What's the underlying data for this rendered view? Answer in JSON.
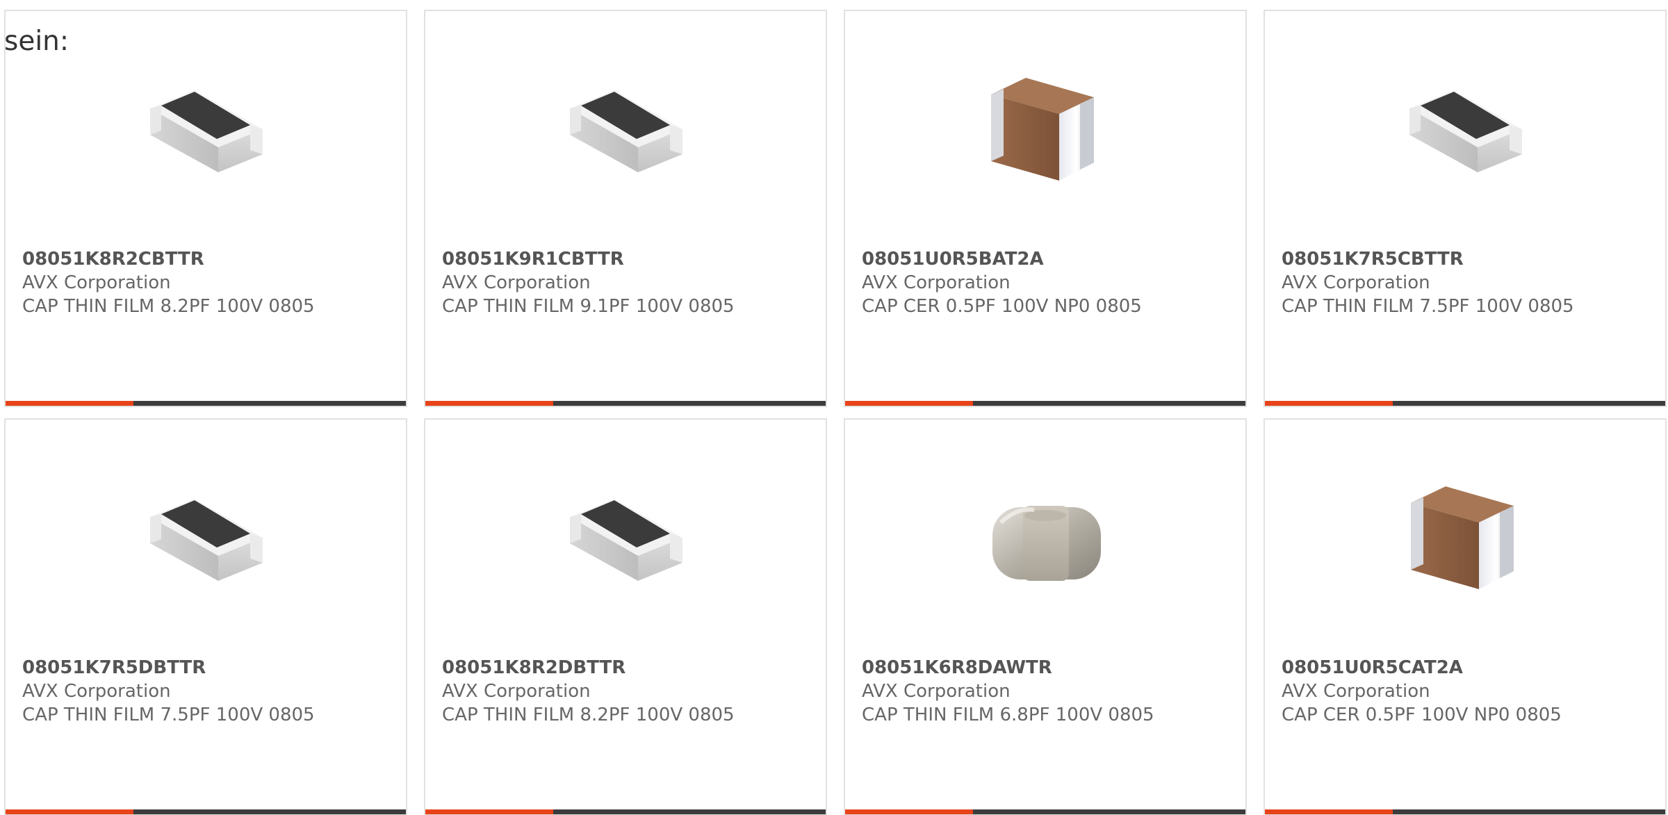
{
  "lead_text": "sein:",
  "colors": {
    "accent": "#e8431a",
    "bar": "#3c3c3c",
    "card_border": "#e1e1e1"
  },
  "products": [
    {
      "part_number": "08051K8R2CBTTR",
      "manufacturer": "AVX Corporation",
      "description": "CAP THIN FILM 8.2PF 100V 0805",
      "image_icon": "thin-film-capacitor-icon"
    },
    {
      "part_number": "08051K9R1CBTTR",
      "manufacturer": "AVX Corporation",
      "description": "CAP THIN FILM 9.1PF 100V 0805",
      "image_icon": "thin-film-capacitor-icon"
    },
    {
      "part_number": "08051U0R5BAT2A",
      "manufacturer": "AVX Corporation",
      "description": "CAP CER 0.5PF 100V NP0 0805",
      "image_icon": "ceramic-capacitor-icon"
    },
    {
      "part_number": "08051K7R5CBTTR",
      "manufacturer": "AVX Corporation",
      "description": "CAP THIN FILM 7.5PF 100V 0805",
      "image_icon": "thin-film-capacitor-icon"
    },
    {
      "part_number": "08051K7R5DBTTR",
      "manufacturer": "AVX Corporation",
      "description": "CAP THIN FILM 7.5PF 100V 0805",
      "image_icon": "thin-film-capacitor-icon"
    },
    {
      "part_number": "08051K8R2DBTTR",
      "manufacturer": "AVX Corporation",
      "description": "CAP THIN FILM 8.2PF 100V 0805",
      "image_icon": "thin-film-capacitor-icon"
    },
    {
      "part_number": "08051K6R8DAWTR",
      "manufacturer": "AVX Corporation",
      "description": "CAP THIN FILM 6.8PF 100V 0805",
      "image_icon": "metal-chip-capacitor-icon"
    },
    {
      "part_number": "08051U0R5CAT2A",
      "manufacturer": "AVX Corporation",
      "description": "CAP CER 0.5PF 100V NP0 0805",
      "image_icon": "ceramic-capacitor-icon"
    }
  ]
}
